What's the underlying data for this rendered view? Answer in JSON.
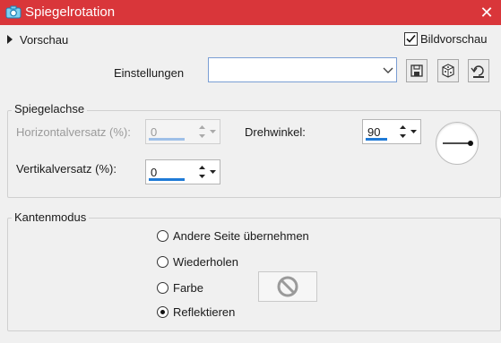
{
  "window": {
    "title": "Spiegelrotation",
    "close_glyph": "✕"
  },
  "preview": {
    "label": "Vorschau"
  },
  "bildvorschau": {
    "label": "Bildvorschau",
    "checked": true
  },
  "settings": {
    "label": "Einstellungen",
    "value": ""
  },
  "mirror_axis": {
    "title": "Spiegelachse",
    "horizontal_label": "Horizontalversatz (%):",
    "horizontal_value": "0",
    "vertical_label": "Vertikalversatz (%):",
    "vertical_value": "0",
    "rotation_label": "Drehwinkel:",
    "rotation_value": "90"
  },
  "edge_mode": {
    "title": "Kantenmodus",
    "options": [
      "Andere Seite übernehmen",
      "Wiederholen",
      "Farbe",
      "Reflektieren"
    ],
    "selected": "Reflektieren"
  },
  "colors": {
    "title_bar": "#d9363a",
    "accent": "#1f7ad6"
  }
}
